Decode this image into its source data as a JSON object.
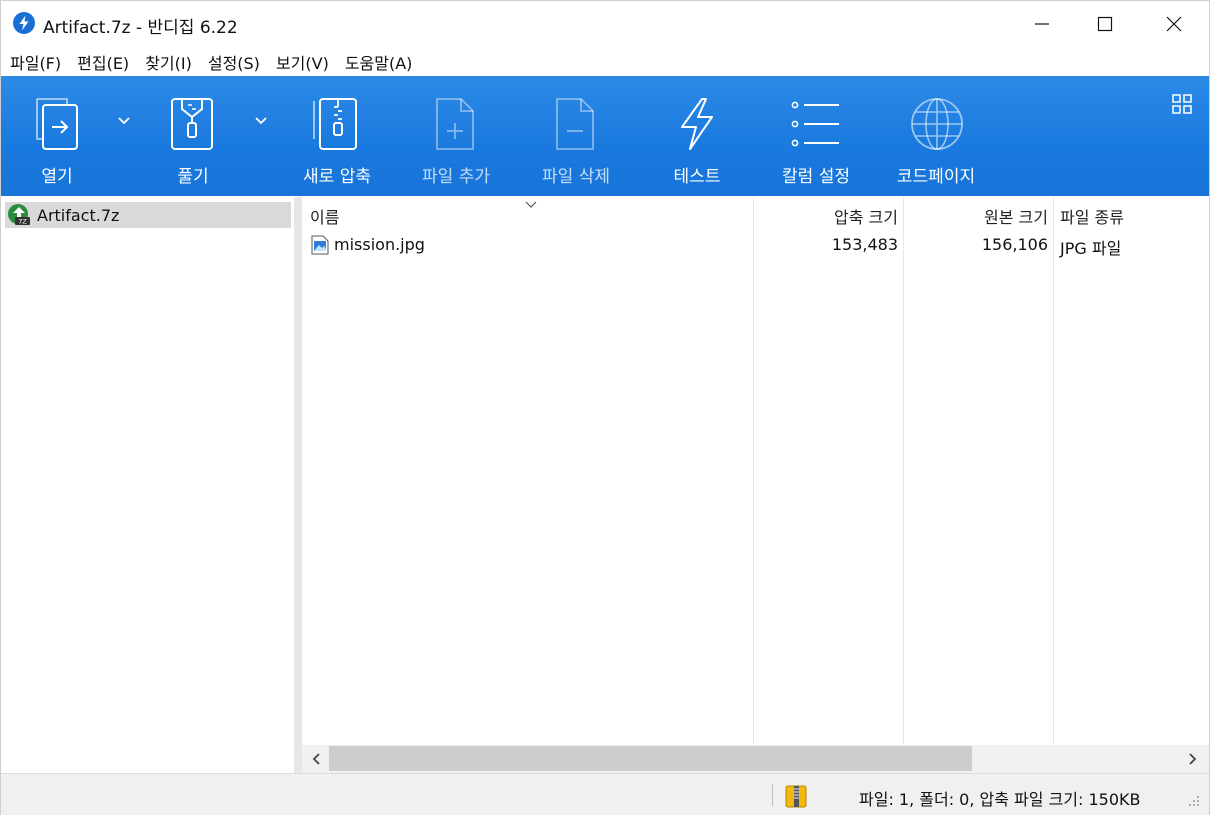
{
  "window": {
    "title": "Artifact.7z - 반디집 6.22"
  },
  "menu": [
    "파일(F)",
    "편집(E)",
    "찾기(I)",
    "설정(S)",
    "보기(V)",
    "도움말(A)"
  ],
  "toolbar": {
    "open": "열기",
    "extract": "풀기",
    "new_archive": "새로 압축",
    "add_files": "파일 추가",
    "delete_files": "파일 삭제",
    "test": "테스트",
    "column_settings": "칼럼 설정",
    "codepage": "코드페이지"
  },
  "tree": {
    "root_label": "Artifact.7z"
  },
  "list": {
    "columns": {
      "name": "이름",
      "packed_size": "압축 크기",
      "original_size": "원본 크기",
      "file_type": "파일 종류"
    },
    "rows": [
      {
        "name": "mission.jpg",
        "packed_size": "153,483",
        "original_size": "156,106",
        "file_type": "JPG 파일"
      }
    ]
  },
  "statusbar": {
    "text": "파일: 1, 폴더: 0, 압축 파일 크기: 150KB"
  },
  "colors": {
    "toolbar_blue": "#1a79de",
    "selection_gray": "#d9d9d9"
  },
  "icons": {
    "app": "bandizip-bolt-icon",
    "open": "open-file-icon",
    "extract": "zip-extract-icon",
    "new_archive": "zip-file-icon",
    "add_files": "file-add-icon",
    "delete_files": "file-remove-icon",
    "test": "lightning-icon",
    "column_settings": "list-icon",
    "codepage": "globe-icon"
  }
}
